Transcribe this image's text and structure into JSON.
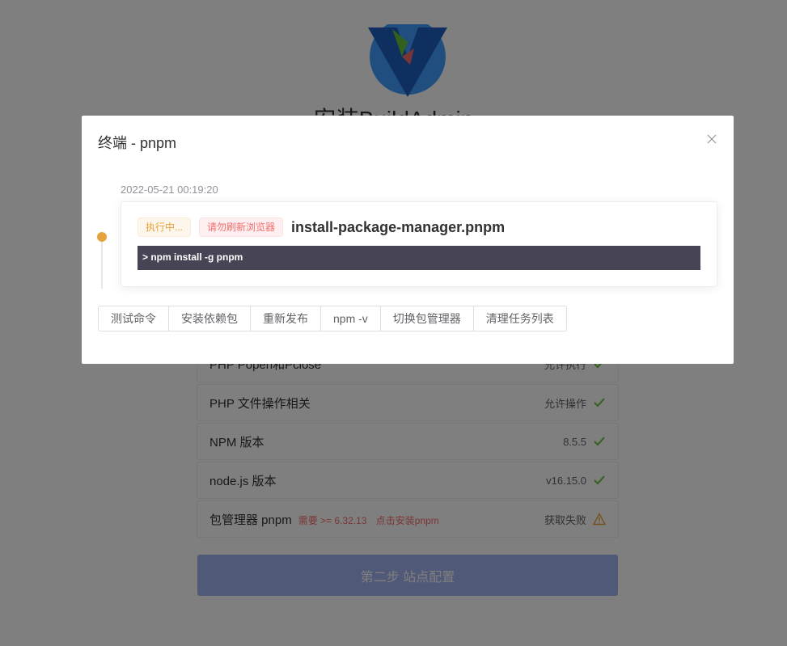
{
  "page": {
    "title": "安装BuildAdmin",
    "check_items": [
      {
        "name": "PHP Popen和Pclose",
        "value": "允许执行",
        "status": "ok"
      },
      {
        "name": "PHP 文件操作相关",
        "value": "允许操作",
        "status": "ok"
      },
      {
        "name": "NPM 版本",
        "value": "8.5.5",
        "status": "ok"
      },
      {
        "name": "node.js 版本",
        "value": "v16.15.0",
        "status": "ok"
      },
      {
        "name": "包管理器 pnpm",
        "hint_require": "需要 >= 6.32.13",
        "hint_action": "点击安装pnpm",
        "value": "获取失败",
        "status": "warn"
      }
    ],
    "next_button": "第二步 站点配置"
  },
  "dialog": {
    "title": "终端 - pnpm",
    "task": {
      "timestamp": "2022-05-21 00:19:20",
      "status_tag": "执行中...",
      "notice_tag": "请勿刷新浏览器",
      "name": "install-package-manager.pnpm",
      "output": "> npm install -g pnpm"
    },
    "buttons": [
      "测试命令",
      "安装依赖包",
      "重新发布",
      "npm -v",
      "切换包管理器",
      "清理任务列表"
    ]
  },
  "colors": {
    "primary": "#409eff",
    "warning": "#e6a23c",
    "danger": "#f56c6c",
    "success": "#67c23a",
    "terminal_bg": "#474555"
  },
  "icons": {
    "close": "close-icon",
    "ok": "check-icon",
    "warn": "warning-icon"
  }
}
